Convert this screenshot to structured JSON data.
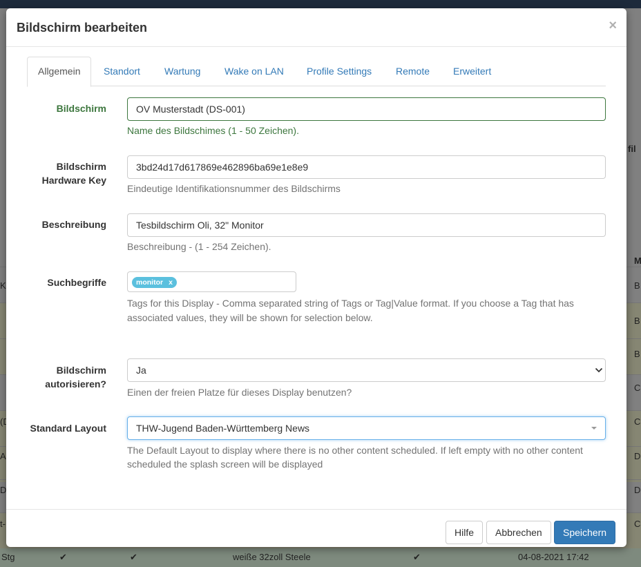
{
  "modal": {
    "title": "Bildschirm bearbeiten",
    "close_symbol": "×"
  },
  "tabs": [
    {
      "label": "Allgemein",
      "active": true
    },
    {
      "label": "Standort"
    },
    {
      "label": "Wartung"
    },
    {
      "label": "Wake on LAN"
    },
    {
      "label": "Profile Settings"
    },
    {
      "label": "Remote"
    },
    {
      "label": "Erweitert"
    }
  ],
  "form": {
    "name": {
      "label": "Bildschirm",
      "value": "OV Musterstadt (DS-001)",
      "help": "Name des Bildschimes (1 - 50 Zeichen)."
    },
    "hardware_key": {
      "label_line1": "Bildschirm",
      "label_line2": "Hardware Key",
      "value": "3bd24d17d617869e462896ba69e1e8e9",
      "help": "Eindeutige Identifikationsnummer des Bildschirms"
    },
    "description": {
      "label": "Beschreibung",
      "value": "Tesbildschirm Oli, 32\" Monitor",
      "help": "Beschreibung - (1 - 254 Zeichen)."
    },
    "tags": {
      "label": "Suchbegriffe",
      "tag_value": "monitor",
      "tag_remove": "x",
      "help_line1": "Tags for this Display - Comma separated string of Tags or Tag|Value format. If you choose a Tag that has",
      "help_line2": "associated values, they will be shown for selection below."
    },
    "authorize": {
      "label_line1": "Bildschirm",
      "label_line2": "autorisieren?",
      "value": "Ja",
      "help": "Einen der freien Platze für dieses Display benutzen?"
    },
    "default_layout": {
      "label": "Standard Layout",
      "value": "THW-Jugend Baden-Württemberg News",
      "help_line1": "The Default Layout to display where there is no other content scheduled. If left empty with no other content",
      "help_line2": "scheduled the splash screen will be displayed"
    }
  },
  "footer": {
    "help_label": "Hilfe",
    "cancel_label": "Abbrechen",
    "save_label": "Speichern"
  },
  "background": {
    "bottom_row": {
      "col1": "Stg",
      "col3": "weiße 32zoll Steele",
      "col5": "04-08-2021 17:42"
    },
    "right_header": "M",
    "right_header2": "fil",
    "right_cells": [
      "B",
      "B",
      "B",
      "C",
      "C",
      "D",
      "D",
      "C"
    ],
    "left_cells": [
      "K",
      "(D",
      "AN",
      "D",
      "t-"
    ]
  },
  "colors": {
    "primary": "#337ab7",
    "success": "#3c763d",
    "tag_bg": "#5bc0de"
  }
}
